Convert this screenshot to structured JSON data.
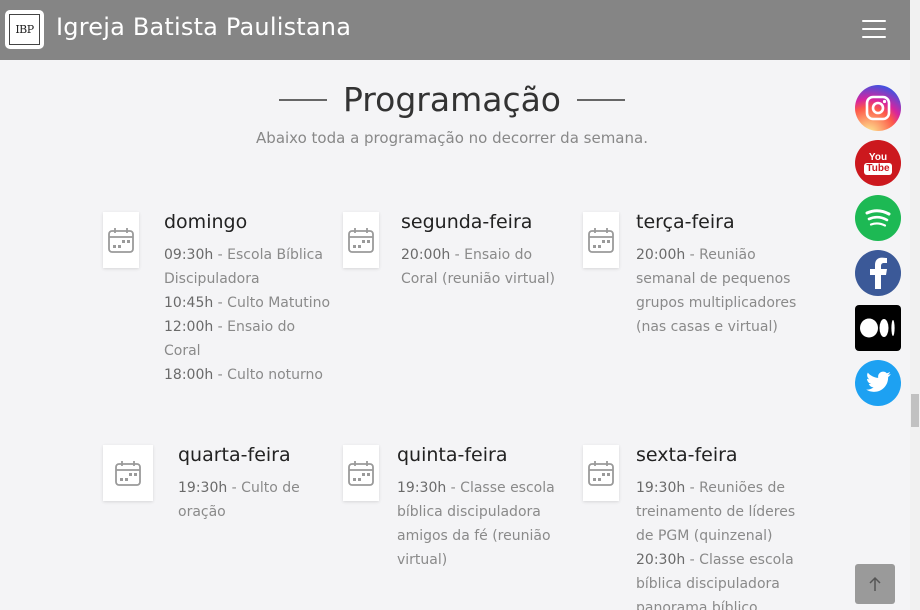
{
  "header": {
    "logo_text": "IBP",
    "title": "Igreja Batista Paulistana"
  },
  "section": {
    "title": "Programação",
    "subtitle": "Abaixo toda a programação no decorrer da semana."
  },
  "schedule": [
    {
      "day": "domingo",
      "entries": [
        {
          "time": "09:30h",
          "desc": " - Escola Bíblica"
        },
        {
          "time": "",
          "desc": "Discipuladora"
        },
        {
          "time": "10:45h",
          "desc": " - Culto Matutino"
        },
        {
          "time": "12:00h",
          "desc": " - Ensaio do"
        },
        {
          "time": "",
          "desc": "Coral"
        },
        {
          "time": "18:00h",
          "desc": " - Culto noturno"
        }
      ]
    },
    {
      "day": "segunda-feira",
      "entries": [
        {
          "time": "20:00h",
          "desc": " - Ensaio do"
        },
        {
          "time": "",
          "desc": "Coral (reunião virtual)"
        }
      ]
    },
    {
      "day": "terça-feira",
      "entries": [
        {
          "time": "20:00h",
          "desc": " - Reunião"
        },
        {
          "time": "",
          "desc": "semanal de pequenos"
        },
        {
          "time": "",
          "desc": "grupos multiplicadores"
        },
        {
          "time": "",
          "desc": "(nas casas e virtual)"
        }
      ]
    },
    {
      "day": "quarta-feira",
      "entries": [
        {
          "time": "19:30h",
          "desc": " - Culto de"
        },
        {
          "time": "",
          "desc": "oração"
        }
      ]
    },
    {
      "day": "quinta-feira",
      "entries": [
        {
          "time": "19:30h",
          "desc": " - Classe escola"
        },
        {
          "time": "",
          "desc": "bíblica discipuladora"
        },
        {
          "time": "",
          "desc": "amigos da fé (reunião"
        },
        {
          "time": "",
          "desc": "virtual)"
        }
      ]
    },
    {
      "day": "sexta-feira",
      "entries": [
        {
          "time": "19:30h",
          "desc": " - Reuniões de"
        },
        {
          "time": "",
          "desc": "treinamento de líderes"
        },
        {
          "time": "",
          "desc": "de PGM (quinzenal)"
        },
        {
          "time": "20:30h",
          "desc": " - Classe escola"
        },
        {
          "time": "",
          "desc": "bíblica discipuladora"
        },
        {
          "time": "",
          "desc": "panorama bíblico"
        }
      ]
    }
  ],
  "social": [
    {
      "name": "instagram",
      "icon": "instagram-icon",
      "color": "#c13584"
    },
    {
      "name": "youtube",
      "icon": "youtube-icon",
      "color": "#cc181e",
      "label_top": "You",
      "label_bottom": "Tube"
    },
    {
      "name": "spotify",
      "icon": "spotify-icon",
      "color": "#1db954"
    },
    {
      "name": "facebook",
      "icon": "facebook-icon",
      "color": "#3b5998"
    },
    {
      "name": "medium",
      "icon": "medium-icon",
      "color": "#000000"
    },
    {
      "name": "twitter",
      "icon": "twitter-icon",
      "color": "#1da1f2"
    }
  ]
}
